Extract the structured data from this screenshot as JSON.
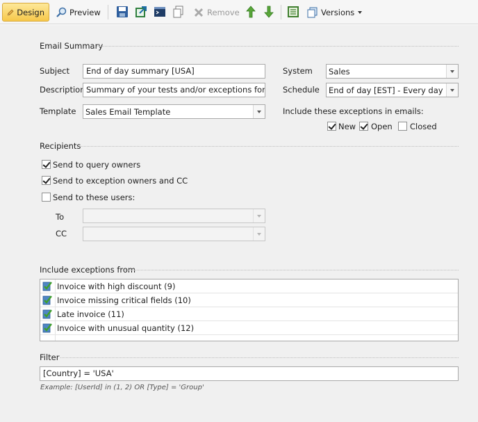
{
  "toolbar": {
    "design_label": "Design",
    "preview_label": "Preview",
    "remove_label": "Remove",
    "versions_label": "Versions"
  },
  "email_summary": {
    "group_title": "Email Summary",
    "subject_label": "Subject",
    "subject_value": "End of day summary [USA]",
    "description_label": "Description",
    "description_value": "Summary of your tests and/or exceptions for USA",
    "template_label": "Template",
    "template_value": "Sales Email Template",
    "system_label": "System",
    "system_value": "Sales",
    "schedule_label": "Schedule",
    "schedule_value": "End of day [EST] - Every day a...",
    "include_label": "Include these exceptions in emails:",
    "statuses": [
      {
        "label": "New",
        "checked": true
      },
      {
        "label": "Open",
        "checked": true
      },
      {
        "label": "Closed",
        "checked": false
      }
    ]
  },
  "recipients": {
    "group_title": "Recipients",
    "query_owners_label": "Send to query owners",
    "query_owners_checked": true,
    "exception_owners_label": "Send to exception owners and CC",
    "exception_owners_checked": true,
    "these_users_label": "Send to these users:",
    "these_users_checked": false,
    "to_label": "To",
    "to_value": "",
    "cc_label": "CC",
    "cc_value": ""
  },
  "exceptions": {
    "group_title": "Include exceptions from",
    "items": [
      {
        "label": "Invoice with high discount (9)",
        "icon": "check-icon"
      },
      {
        "label": "Invoice missing critical fields (10)",
        "icon": "check-icon"
      },
      {
        "label": "Late invoice (11)",
        "icon": "check-icon"
      },
      {
        "label": "Invoice with unusual quantity (12)",
        "icon": "check-icon"
      }
    ]
  },
  "filter": {
    "group_title": "Filter",
    "value": "[Country] = 'USA'",
    "example": "Example: [UserId] in (1, 2) OR [Type] = 'Group'"
  }
}
